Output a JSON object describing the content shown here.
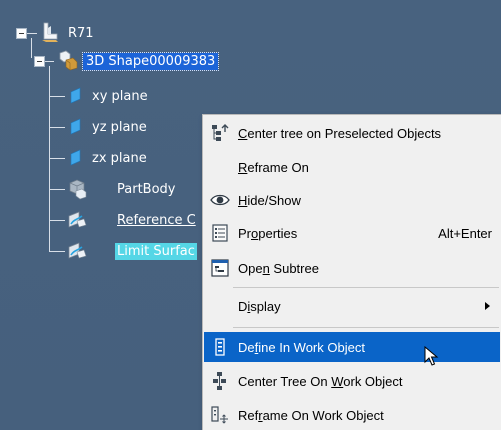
{
  "tree": {
    "root": {
      "label": "R71",
      "icon": "product-icon"
    },
    "shape": {
      "label": "3D Shape00009383",
      "icon": "3d-shape-icon"
    },
    "children": [
      {
        "label": "xy plane",
        "icon": "plane-icon"
      },
      {
        "label": "yz plane",
        "icon": "plane-icon"
      },
      {
        "label": "zx plane",
        "icon": "plane-icon"
      },
      {
        "label": "PartBody",
        "icon": "partbody-icon"
      },
      {
        "label": "Reference C",
        "icon": "geometrical-set-icon"
      },
      {
        "label": "Limit Surfac",
        "icon": "geometrical-set-icon"
      }
    ]
  },
  "menu": {
    "items": [
      {
        "pre": "",
        "u": "C",
        "post": "enter tree on Preselected Objects",
        "icon": "center-tree-icon"
      },
      {
        "pre": "",
        "u": "R",
        "post": "eframe On",
        "icon": ""
      },
      {
        "pre": "",
        "u": "H",
        "post": "ide/Show",
        "icon": "eye-icon"
      },
      {
        "pre": "Pr",
        "u": "o",
        "post": "perties",
        "shortcut": "Alt+Enter",
        "icon": "properties-icon"
      },
      {
        "pre": "Ope",
        "u": "n",
        "post": " Subtree",
        "icon": "open-subtree-icon"
      },
      {
        "pre": "D",
        "u": "i",
        "post": "splay",
        "icon": ""
      },
      {
        "pre": "De",
        "u": "f",
        "post": "ine In Work Object",
        "icon": "define-work-object-icon"
      },
      {
        "pre": "Center Tree On ",
        "u": "W",
        "post": "ork Object",
        "icon": "center-work-object-icon"
      },
      {
        "pre": "Ref",
        "u": "r",
        "post": "ame On Work Object",
        "icon": "reframe-work-object-icon"
      }
    ]
  },
  "colors": {
    "background": "#46607e",
    "menu_highlight": "#0a64c8",
    "selection_blue": "#1c64d8",
    "selection_cyan": "#55d6e6"
  }
}
